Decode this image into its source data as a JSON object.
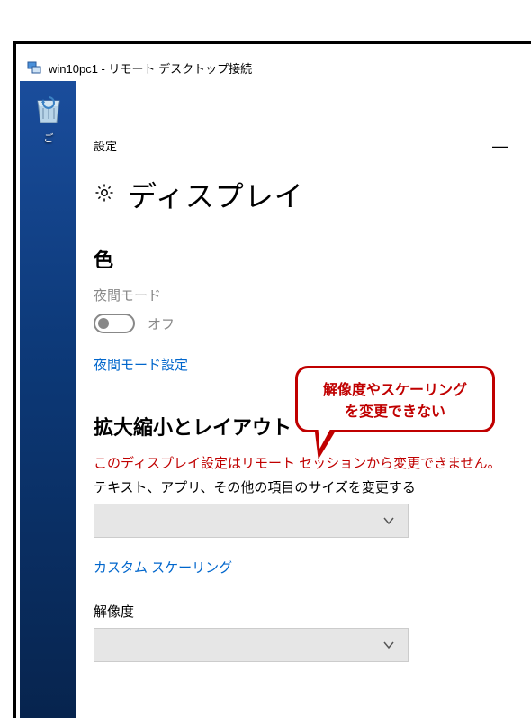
{
  "rdp": {
    "title": "win10pc1 - リモート デスクトップ接続"
  },
  "desktop": {
    "recycle_label": "ご"
  },
  "settings": {
    "header_label": "設定",
    "page_title": "ディスプレイ",
    "color_heading": "色",
    "night_mode_label": "夜間モード",
    "night_mode_state": "オフ",
    "night_mode_link": "夜間モード設定",
    "scale_heading": "拡大縮小とレイアウト",
    "warning": "このディスプレイ設定はリモート セッションから変更できません。",
    "scale_label": "テキスト、アプリ、その他の項目のサイズを変更する",
    "custom_scale_link": "カスタム スケーリング",
    "resolution_label": "解像度"
  },
  "callout": {
    "line1": "解像度やスケーリング",
    "line2": "を変更できない"
  }
}
